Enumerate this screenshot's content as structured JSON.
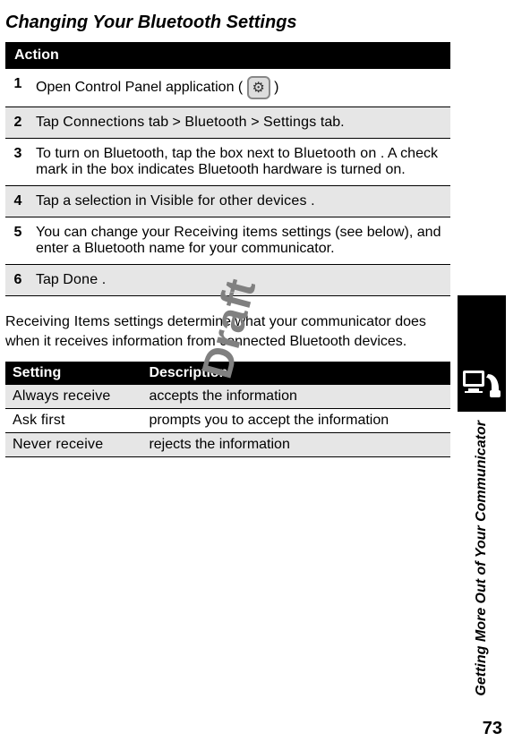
{
  "title": "Changing Your Bluetooth Settings",
  "action_header": "Action",
  "steps": [
    {
      "n": "1",
      "pre": "Open Control Panel application ( ",
      "icon": true,
      "post": " )"
    },
    {
      "n": "2",
      "pre": "Tap ",
      "b1": "Connections",
      "m1": " tab > ",
      "b2": "Bluetooth",
      "m2": " >  ",
      "b3": "Settings",
      "post": " tab."
    },
    {
      "n": "3",
      "pre": "To turn on Bluetooth, tap the box next to ",
      "b1": "Bluetooth on",
      "post": ". A check mark in the box indicates Bluetooth hardware is turned on."
    },
    {
      "n": "4",
      "pre": "Tap a selection in ",
      "b1": "Visible for other devices",
      "post": "."
    },
    {
      "n": "5",
      "pre": "You can change your  ",
      "b1": "Receiving items",
      "post": " settings (see below), and enter a Bluetooth name for your communicator."
    },
    {
      "n": "6",
      "pre": "Tap ",
      "b1": "Done",
      "post": "."
    }
  ],
  "receiving_lead_bold": "Receiving Items",
  "receiving_lead_rest": " settings determine what your communicator does when it receives information from connected Bluetooth devices.",
  "settings_headers": {
    "c1": "Setting",
    "c2": "Description"
  },
  "settings_rows": [
    {
      "setting": "Always receive",
      "desc": "accepts the information"
    },
    {
      "setting": "Ask first",
      "desc": "prompts you to accept the information"
    },
    {
      "setting": "Never receive",
      "desc": "rejects the information"
    }
  ],
  "watermark": "Draft",
  "side_title": "Getting More Out of Your Communicator",
  "page_number": "73"
}
